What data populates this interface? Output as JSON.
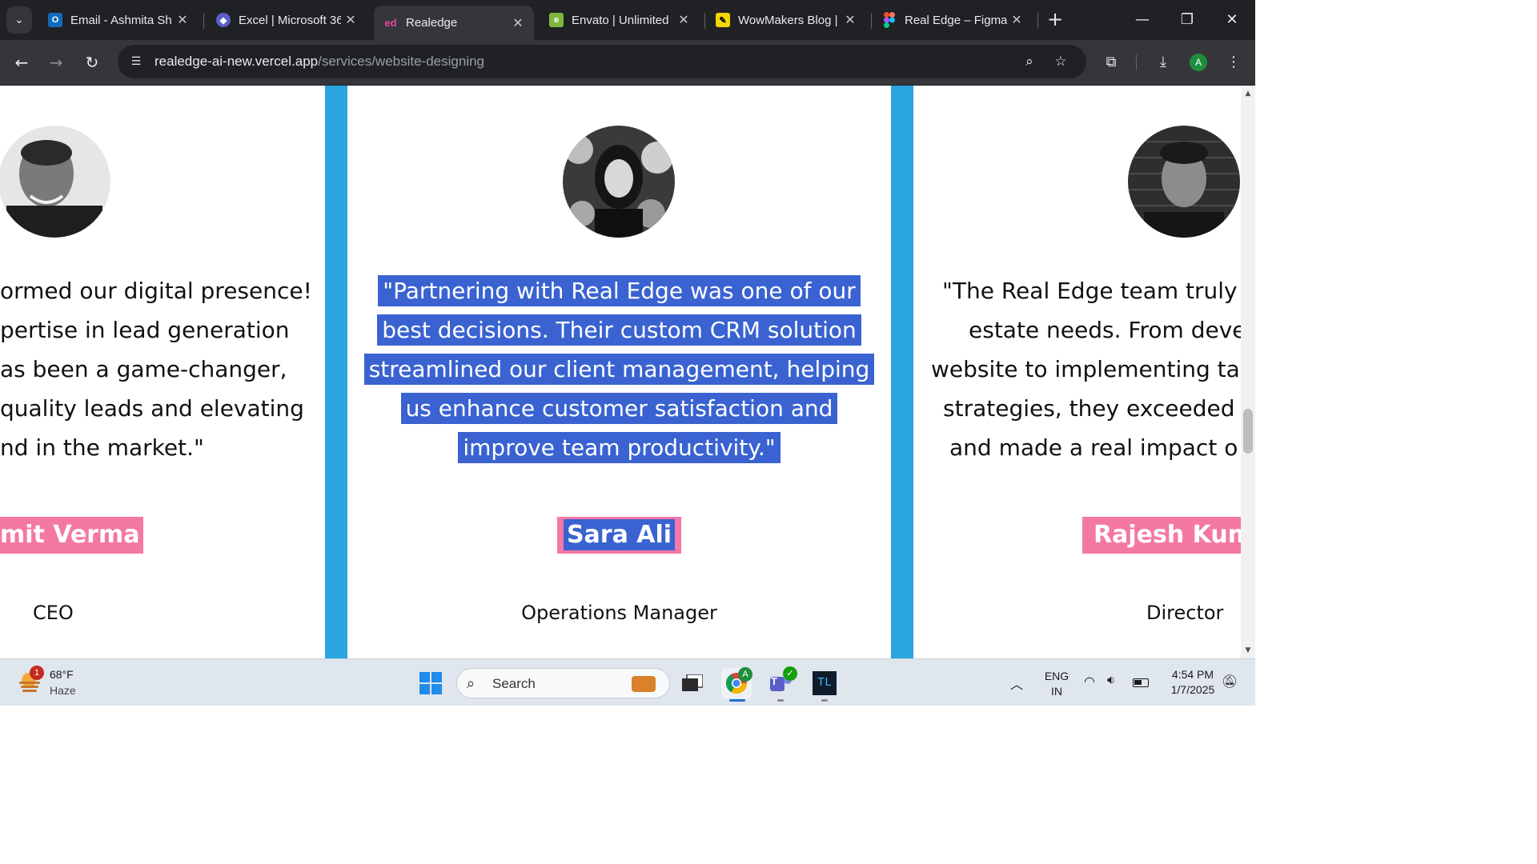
{
  "browser": {
    "tabs": [
      {
        "title": "Email - Ashmita Sh",
        "icon": "outlook-icon",
        "color": "#0f6cbd"
      },
      {
        "title": "Excel | Microsoft 36",
        "icon": "copilot-icon",
        "color": "#5b5fc7"
      },
      {
        "title": "Realedge",
        "icon": "realedge-icon",
        "color": "#e0479e",
        "active": true
      },
      {
        "title": "Envato | Unlimited",
        "icon": "envato-icon",
        "color": "#82b541"
      },
      {
        "title": "WowMakers Blog |",
        "icon": "wowmakers-icon",
        "color": "#f2d600"
      },
      {
        "title": "Real Edge – Figma",
        "icon": "figma-icon",
        "color": "#f24e1e"
      }
    ],
    "url_host": "realedge-ai-new.vercel.app",
    "url_path": "/services/website-designing",
    "profile_initial": "A"
  },
  "testimonials": [
    {
      "quote_lines": [
        "ormed our digital presence!",
        "pertise in lead generation",
        "as been a game-changer,",
        "quality leads and elevating",
        "nd in the market.\""
      ],
      "name": "mit Verma",
      "role": "CEO"
    },
    {
      "quote_lines": [
        "\"Partnering with Real Edge was one of our",
        "best decisions. Their custom CRM solution",
        "streamlined our client management, helping",
        "us enhance customer satisfaction and",
        "improve team productivity.\""
      ],
      "name": "Sara Ali",
      "role": "Operations Manager"
    },
    {
      "quote_lines": [
        "\"The Real Edge team truly u",
        "estate needs. From deve",
        "website to implementing ta",
        "strategies, they exceeded",
        "and made a real impact o"
      ],
      "name": "Rajesh Kum",
      "role": "Director"
    }
  ],
  "colors": {
    "accent_stripe": "#29a6e0",
    "name_badge": "#f478a4",
    "selection": "#3a63d1"
  },
  "taskbar": {
    "weather_temp": "68°F",
    "weather_desc": "Haze",
    "weather_badge": "1",
    "search_label": "Search",
    "teams_label": "T",
    "terminal_label": "TL",
    "lang_top": "ENG",
    "lang_bottom": "IN",
    "time": "4:54 PM",
    "date": "1/7/2025"
  }
}
